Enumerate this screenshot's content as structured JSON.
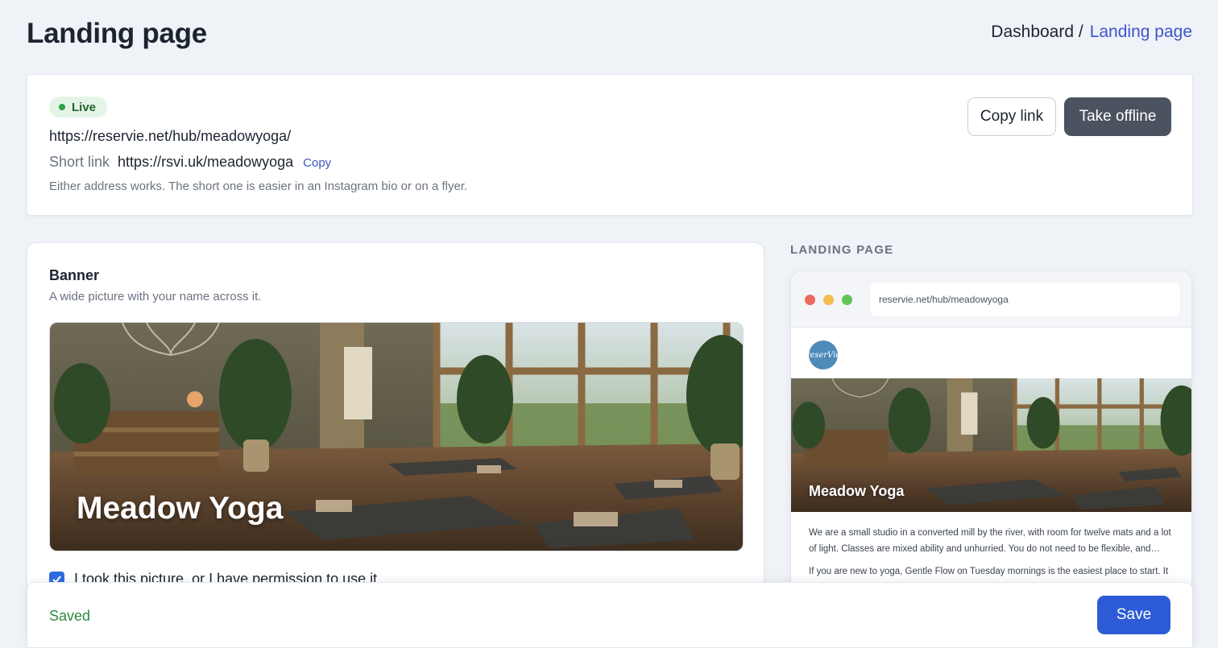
{
  "header": {
    "title": "Landing page",
    "breadcrumb": {
      "root": "Dashboard /",
      "current": "Landing page"
    }
  },
  "status": {
    "badge": "Live",
    "full_url": "https://reservie.net/hub/meadowyoga/",
    "short_link_label": "Short link",
    "short_link_value": "https://rsvi.uk/meadowyoga",
    "copy_inline": "Copy",
    "hint": "Either address works. The short one is easier in an Instagram bio or on a flyer.",
    "copy_link_button": "Copy link",
    "take_offline_button": "Take offline"
  },
  "banner": {
    "title": "Banner",
    "subtitle": "A wide picture with your name across it.",
    "overlay_name": "Meadow Yoga",
    "permission_label": "I took this picture, or I have permission to use it",
    "permission_checked": true
  },
  "preview": {
    "label": "LANDING PAGE",
    "url": "reservie.net/hub/meadowyoga",
    "logo_text": "reserVie",
    "banner_name": "Meadow Yoga",
    "para1": "We are a small studio in a converted mill by the river, with room for twelve mats and a lot of light. Classes are mixed ability and unhurried. You do not need to be flexible, and…",
    "para2": "If you are new to yoga, Gentle Flow on Tuesday mornings is the easiest place to start. It"
  },
  "footer": {
    "status": "Saved",
    "save_button": "Save"
  },
  "colors": {
    "accent": "#3e55c7",
    "save": "#2d5bd6",
    "live_bg": "#e3f5e6",
    "saved": "#2e8a3e",
    "dark_button": "#4b5360"
  }
}
